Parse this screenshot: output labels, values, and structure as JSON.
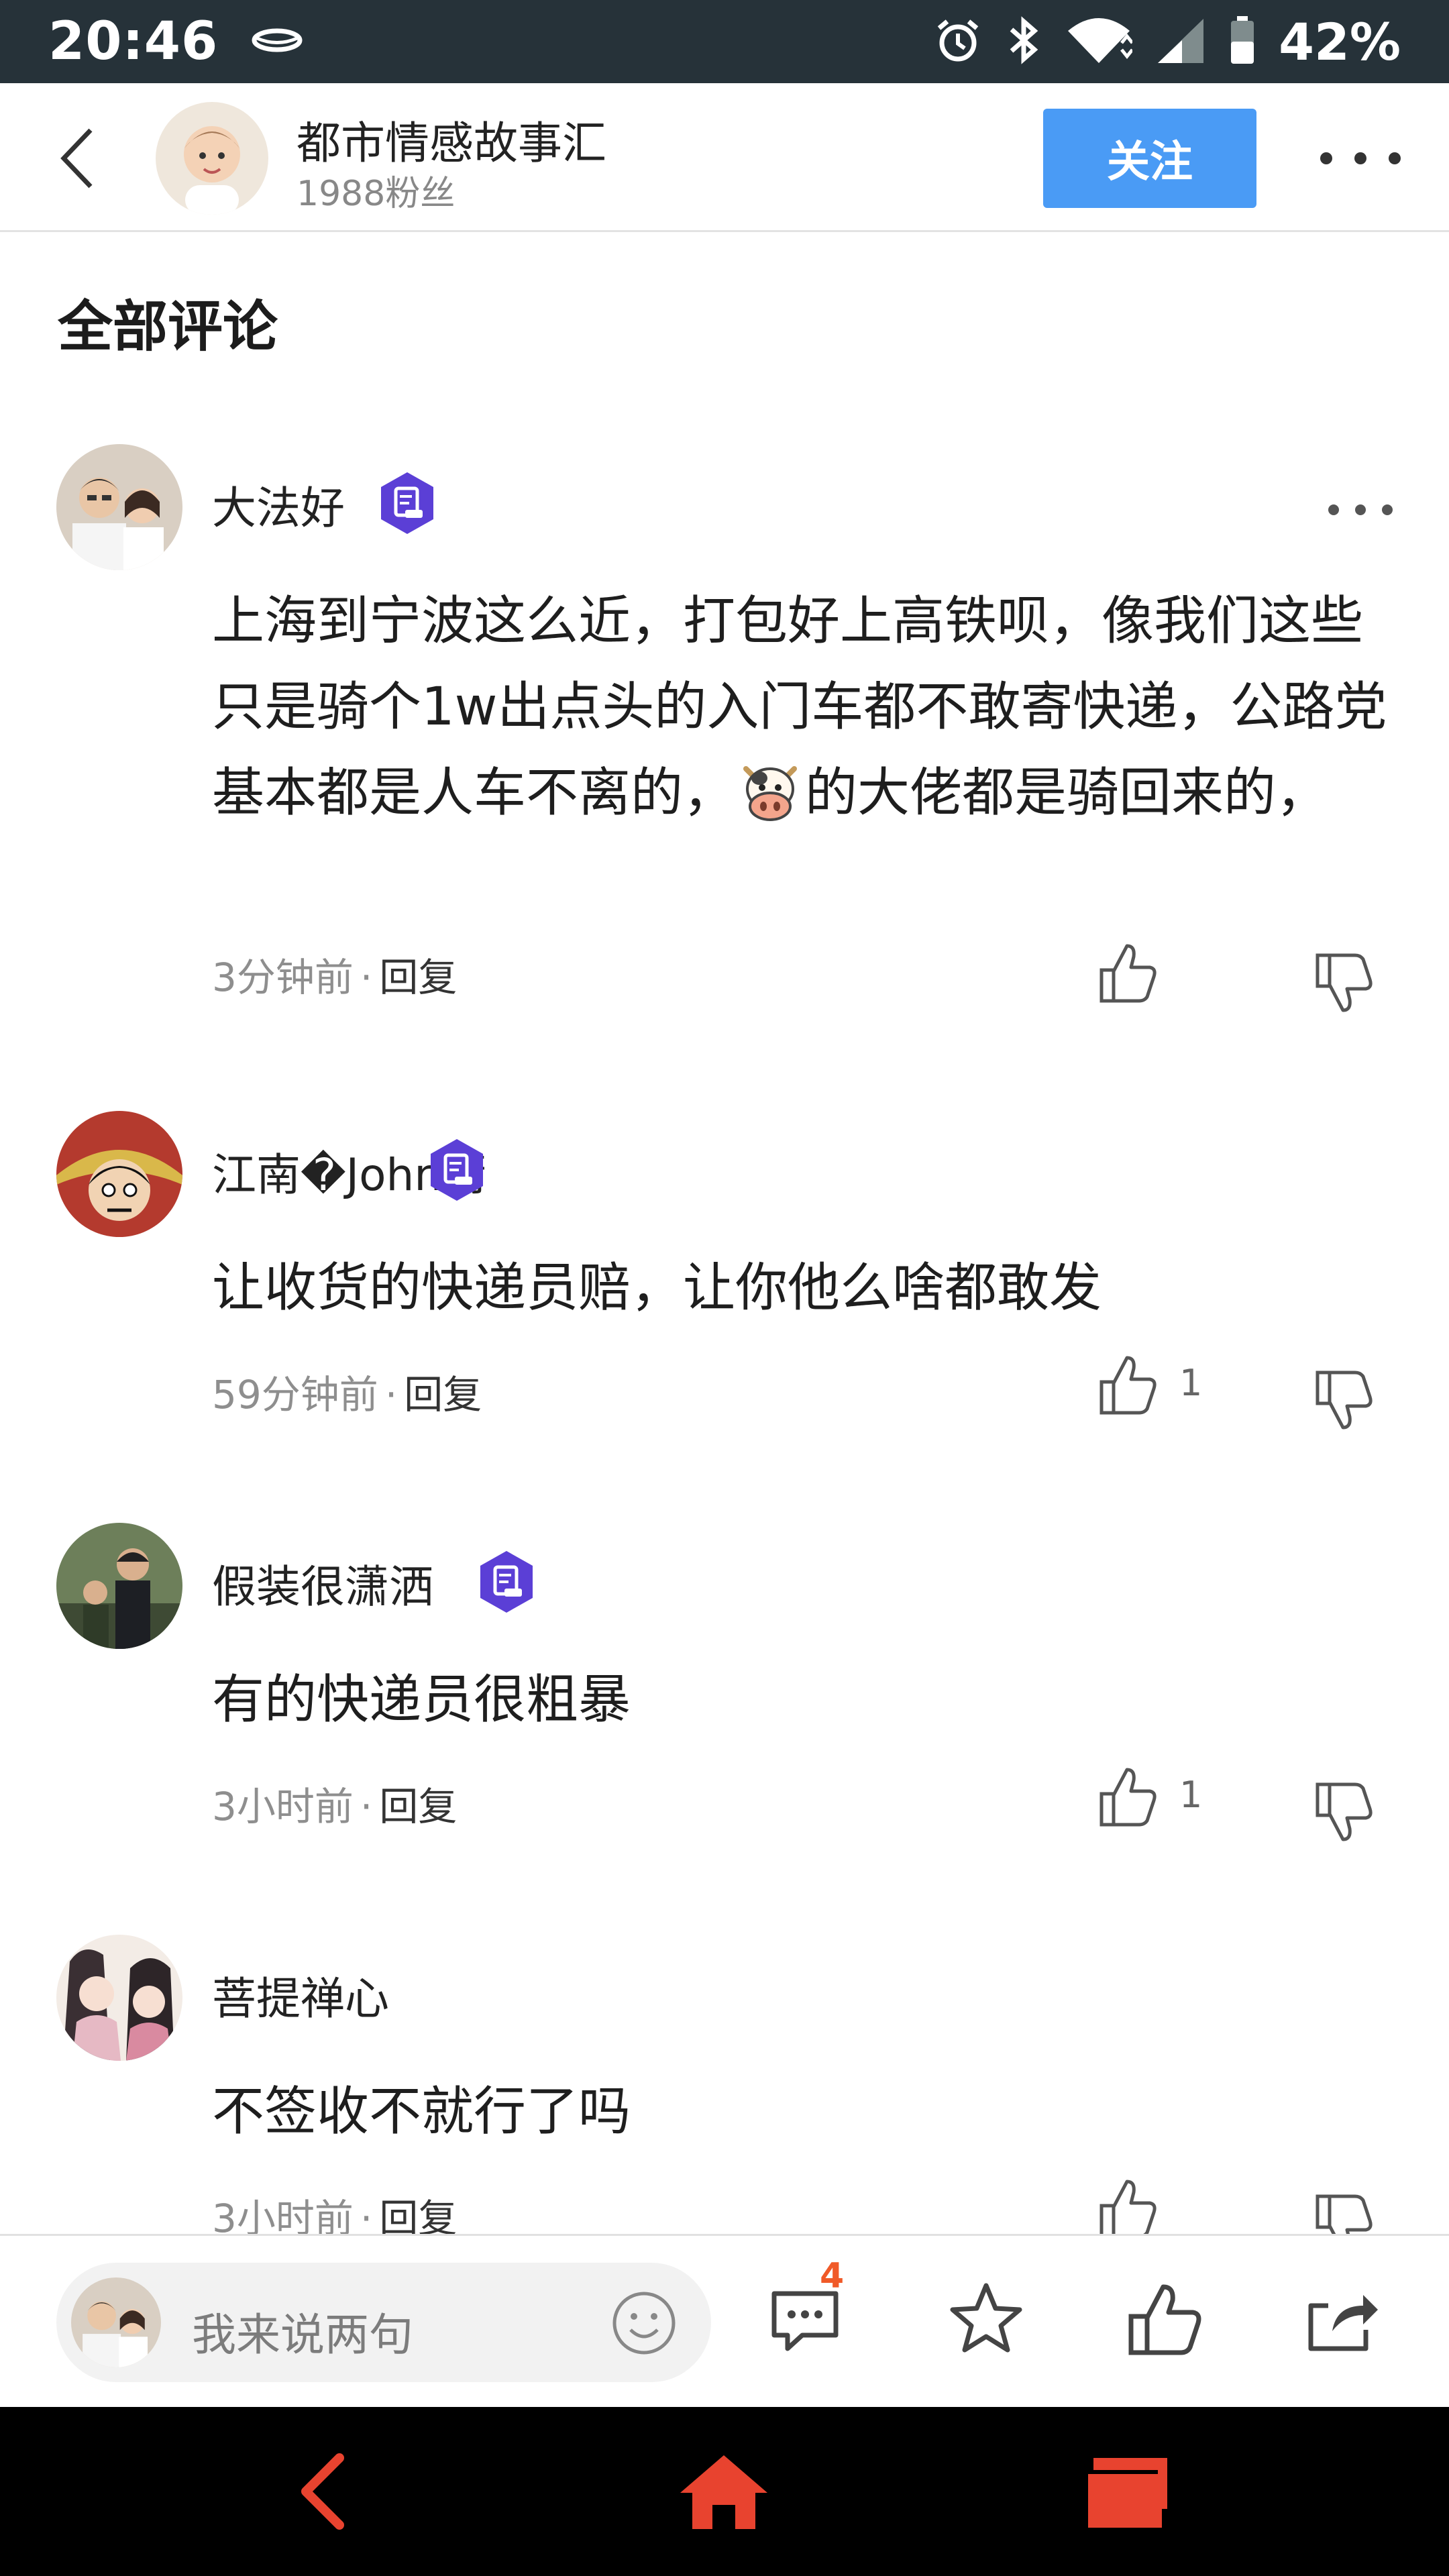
{
  "status_bar": {
    "time": "20:46",
    "battery": "42%"
  },
  "header": {
    "account_name": "都市情感故事汇",
    "followers": "1988粉丝",
    "follow_label": "关注"
  },
  "section_title": "全部评论",
  "comments": [
    {
      "name": "大法好",
      "text_before_emoji": "上海到宁波这么近，打包好上高铁呗，像我们这些只是骑个1w出点头的入门车都不敢寄快递，公路党基本都是人车不离的，",
      "text_after_emoji": "的大佬都是骑回来的，",
      "emoji": "cow-face",
      "time": "3分钟前",
      "reply_label": "回复",
      "likes": ""
    },
    {
      "name": "江南�John箭",
      "text": "让收货的快递员赔，让你他么啥都敢发",
      "time": "59分钟前",
      "reply_label": "回复",
      "likes": "1"
    },
    {
      "name": "假装很潇洒",
      "text": "有的快递员很粗暴",
      "time": "3小时前",
      "reply_label": "回复",
      "likes": "1"
    },
    {
      "name": "菩提禅心",
      "text": "不签收不就行了吗",
      "time": "3小时前",
      "reply_label": "回复",
      "likes": ""
    }
  ],
  "bottom_bar": {
    "input_placeholder": "我来说两句",
    "comment_count": "4",
    "icons": [
      "comment-icon",
      "star-icon",
      "thumbs-up-icon",
      "share-icon"
    ]
  },
  "nav_bar": {
    "icons": [
      "back-icon",
      "home-icon",
      "recent-apps-icon"
    ],
    "accent_color": "#e8432f"
  },
  "colors": {
    "status_bar_bg": "#263239",
    "follow_button": "#4a9bf5",
    "badge_purple": "#5b3fd6",
    "comment_badge": "#f05a28"
  }
}
